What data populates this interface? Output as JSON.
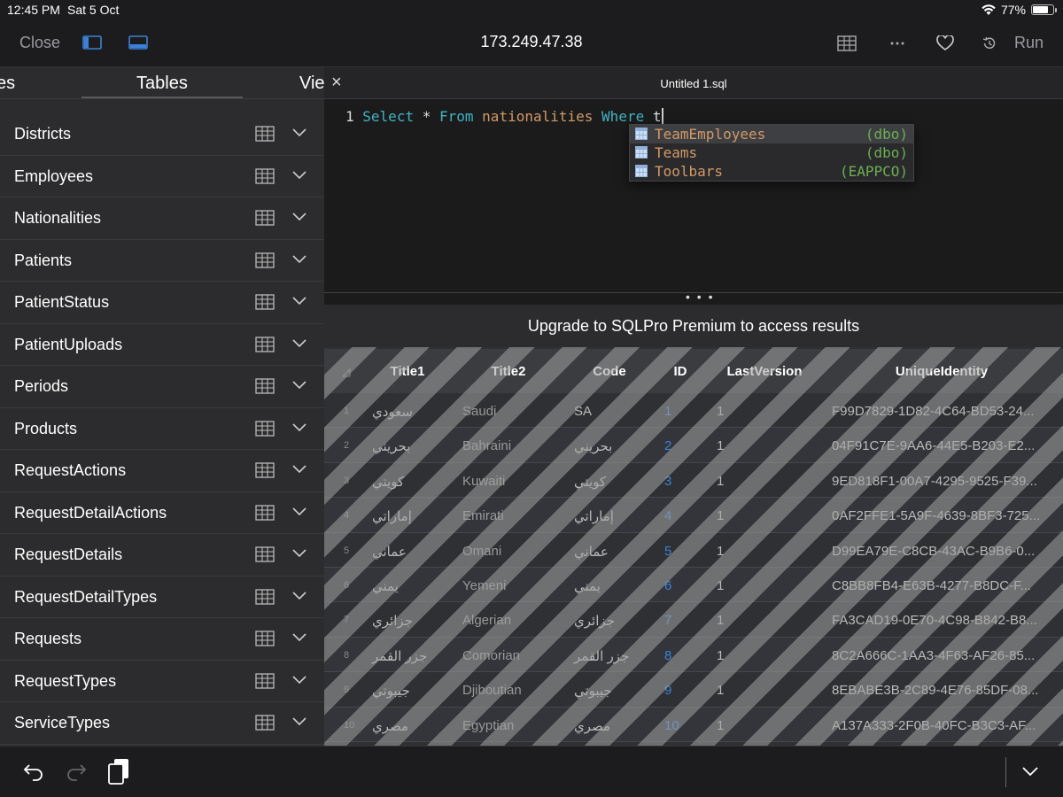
{
  "status_bar": {
    "time": "12:45 PM",
    "date": "Sat 5 Oct",
    "battery_text": "77%",
    "battery_level": 0.77
  },
  "toolbar": {
    "close_label": "Close",
    "title": "173.249.47.38",
    "run_label": "Run"
  },
  "sidebar": {
    "tabs": [
      "es",
      "Tables",
      "Vie"
    ],
    "tables": [
      "Districts",
      "Employees",
      "Nationalities",
      "Patients",
      "PatientStatus",
      "PatientUploads",
      "Periods",
      "Products",
      "RequestActions",
      "RequestDetailActions",
      "RequestDetails",
      "RequestDetailTypes",
      "Requests",
      "RequestTypes",
      "ServiceTypes"
    ]
  },
  "editor": {
    "tab_title": "Untitled 1.sql",
    "line_number": "1",
    "tokens": {
      "select": "Select",
      "star": "*",
      "from": "From",
      "table": "nationalities",
      "where": "Where",
      "typed": "t"
    },
    "autocomplete": [
      {
        "name": "TeamEmployees",
        "schema": "(dbo)"
      },
      {
        "name": "Teams",
        "schema": "(dbo)"
      },
      {
        "name": "Toolbars",
        "schema": "(EAPPCO)"
      }
    ]
  },
  "divider_dots": "• • •",
  "upgrade_message": "Upgrade to SQLPro Premium to access results",
  "results": {
    "columns": [
      "Title1",
      "Title2",
      "Code",
      "ID",
      "LastVersion",
      "UniqueIdentity"
    ],
    "rows": [
      {
        "n": "1",
        "title1": "سعودي",
        "title2": "Saudi",
        "code": "SA",
        "id": "1",
        "lv": "1",
        "uid": "F99D7829-1D82-4C64-BD53-24..."
      },
      {
        "n": "2",
        "title1": "بحريني",
        "title2": "Bahraini",
        "code": "بحريني",
        "id": "2",
        "lv": "1",
        "uid": "04F91C7E-9AA6-44E5-B203-E2..."
      },
      {
        "n": "3",
        "title1": "كويتي",
        "title2": "Kuwaiti",
        "code": "كويتي",
        "id": "3",
        "lv": "1",
        "uid": "9ED818F1-00A7-4295-9525-F39..."
      },
      {
        "n": "4",
        "title1": "إماراتي",
        "title2": "Emirati",
        "code": "إماراتي",
        "id": "4",
        "lv": "1",
        "uid": "0AF2FFE1-5A9F-4639-8BF3-725..."
      },
      {
        "n": "5",
        "title1": "عماني",
        "title2": "Omani",
        "code": "عماني",
        "id": "5",
        "lv": "1",
        "uid": "D99EA79E-C8CB-43AC-B9B6-0..."
      },
      {
        "n": "6",
        "title1": "يمني",
        "title2": "Yemeni",
        "code": "يمني",
        "id": "6",
        "lv": "1",
        "uid": "C8BB8FB4-E63B-4277-B8DC-F..."
      },
      {
        "n": "7",
        "title1": "جزائري",
        "title2": "Algerian",
        "code": "جزائري",
        "id": "7",
        "lv": "1",
        "uid": "FA3CAD19-0E70-4C98-B842-B8..."
      },
      {
        "n": "8",
        "title1": "جزر القمر",
        "title2": "Comorian",
        "code": "جزر القمر",
        "id": "8",
        "lv": "1",
        "uid": "8C2A666C-1AA3-4F63-AF26-85..."
      },
      {
        "n": "9",
        "title1": "جيبوتي",
        "title2": "Djiboutian",
        "code": "جيبوتي",
        "id": "9",
        "lv": "1",
        "uid": "8EBABE3B-2C89-4E76-85DF-08..."
      },
      {
        "n": "10",
        "title1": "مصري",
        "title2": "Egyptian",
        "code": "مصري",
        "id": "10",
        "lv": "1",
        "uid": "A137A333-2F0B-40FC-B3C3-AF..."
      }
    ]
  },
  "colors": {
    "accent_blue": "#3b82d6",
    "keyword": "#3fb5c4",
    "identifier": "#d19a66",
    "schema": "#6aaf52"
  },
  "icons": {
    "toolbar": [
      "sidebar-left-icon",
      "bottom-panel-icon",
      "table-grid-icon",
      "more-dots-icon",
      "heart-icon",
      "history-icon"
    ],
    "bottom": [
      "undo-icon",
      "redo-icon",
      "clipboard-icon",
      "chevron-down-icon"
    ]
  }
}
